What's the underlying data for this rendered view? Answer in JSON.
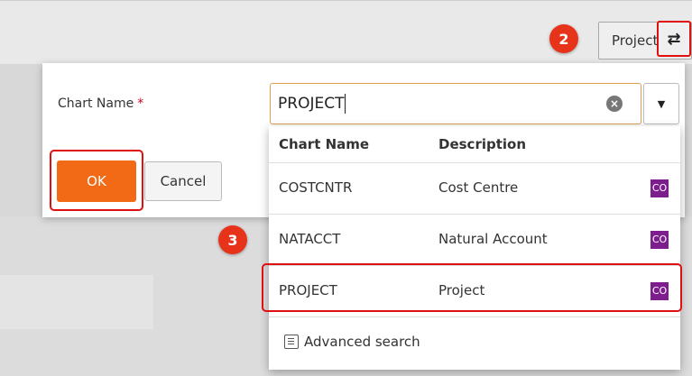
{
  "background": {
    "project_button_label": "Project",
    "swap_icon": "swap-arrows-icon"
  },
  "annotations": {
    "badge_2": "2",
    "badge_3": "3"
  },
  "dialog": {
    "chart_name_label": "Chart Name",
    "required_marker": "*",
    "input_value": "PROJECT",
    "ok_label": "OK",
    "cancel_label": "Cancel"
  },
  "dropdown": {
    "headers": {
      "chart_name": "Chart Name",
      "description": "Description"
    },
    "rows": [
      {
        "name": "COSTCNTR",
        "description": "Cost Centre",
        "tag": "CO"
      },
      {
        "name": "NATACCT",
        "description": "Natural Account",
        "tag": "CO"
      },
      {
        "name": "PROJECT",
        "description": "Project",
        "tag": "CO"
      }
    ],
    "advanced_search_label": "Advanced search"
  },
  "colors": {
    "accent": "#f26a16",
    "highlight": "#e01010",
    "tag": "#7e1e8e",
    "badge": "#e8331b"
  }
}
